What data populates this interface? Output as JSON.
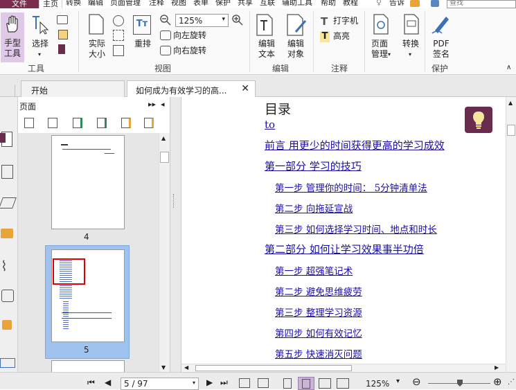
{
  "menu": {
    "file": "文件",
    "home": "主页",
    "items": [
      "转换",
      "编辑",
      "页面管理",
      "注释",
      "视图",
      "表单",
      "保护",
      "共享",
      "互联",
      "辅助工具",
      "帮助",
      "教程"
    ],
    "tell": "告诉",
    "search_placeholder": "查找"
  },
  "ribbon": {
    "hand": "手型\n工具",
    "select": "选择",
    "tools_group": "工具",
    "actual_size": "实际\n大小",
    "reflow": "重排",
    "zoom_value": "125%",
    "rotate_left": "向左旋转",
    "rotate_right": "向右旋转",
    "view_group": "视图",
    "edit_text": "编辑\n文本",
    "edit_object": "编辑\n对象",
    "edit_group": "编辑",
    "typewriter": "打字机",
    "highlight": "高亮",
    "annotate_group": "注释",
    "page_manage": "页面\n管理",
    "convert": "转换",
    "pdf_sign": "PDF\n签名",
    "protect_group": "保护"
  },
  "tabs": [
    {
      "label": "开始"
    },
    {
      "label": "如何成为有效学习的高..."
    }
  ],
  "pages_panel": {
    "title": "页面",
    "thumb_numbers": [
      "4",
      "5"
    ]
  },
  "document": {
    "heading": "目录",
    "toc": [
      {
        "text": "to",
        "level": 1
      },
      {
        "text": "前言 用更少的时间获得更高的学习成效",
        "level": 1
      },
      {
        "text": "第一部分 学习的技巧",
        "level": 1
      },
      {
        "text": "第一步 管理你的时间： 5分钟清单法",
        "level": 2
      },
      {
        "text": "第二步 向拖延宣战",
        "level": 2
      },
      {
        "text": "第三步 如何选择学习时间、地点和时长",
        "level": 2
      },
      {
        "text": "第二部分 如何让学习效果事半功倍",
        "level": 1
      },
      {
        "text": "第一步 超强笔记术",
        "level": 2
      },
      {
        "text": "第二步 避免思维疲劳",
        "level": 2
      },
      {
        "text": "第三步 整理学习资源",
        "level": 2
      },
      {
        "text": "第四步 如何有效记忆",
        "level": 2
      },
      {
        "text": "第五步 快速消灭问题",
        "level": 2
      }
    ]
  },
  "status": {
    "page": "5 / 97",
    "zoom": "125%"
  },
  "colors": {
    "brand": "#7b2d4e",
    "link": "#1a0dab",
    "selection": "#9fc2ee",
    "highlight_box": "#e00000"
  }
}
